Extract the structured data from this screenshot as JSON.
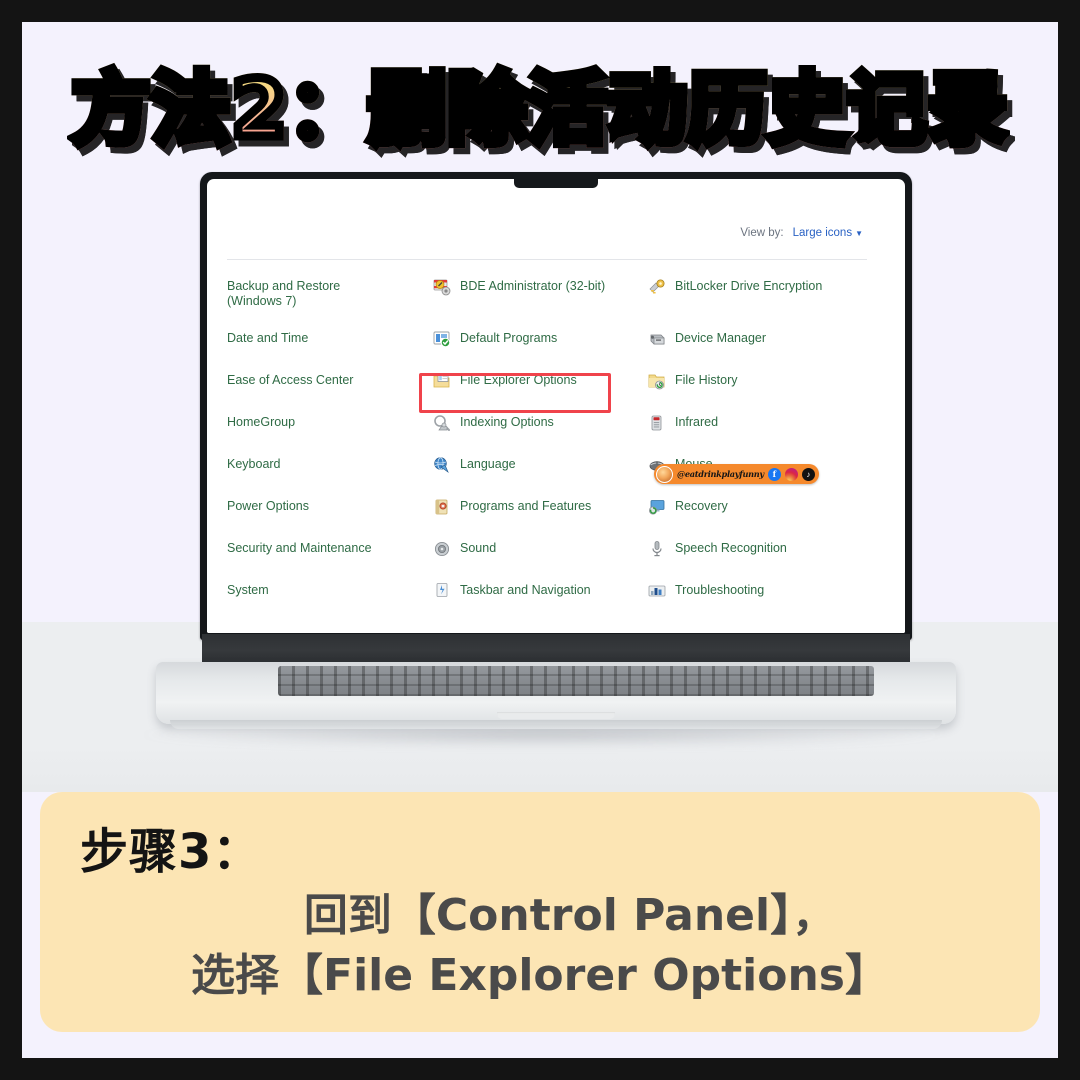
{
  "title": "方法2：删除活动历史记录",
  "control_panel": {
    "view_by": {
      "label": "View by:",
      "value": "Large icons",
      "caret": "▼"
    },
    "items": [
      [
        {
          "label": "Backup and Restore\n(Windows 7)",
          "icon": ""
        },
        {
          "label": "BDE Administrator (32-bit)",
          "icon": "bde-administrator-icon"
        },
        {
          "label": "BitLocker Drive Encryption",
          "icon": "bitlocker-icon"
        }
      ],
      [
        {
          "label": "Date and Time",
          "icon": ""
        },
        {
          "label": "Default Programs",
          "icon": "default-programs-icon"
        },
        {
          "label": "Device Manager",
          "icon": "device-manager-icon"
        }
      ],
      [
        {
          "label": "Ease of Access Center",
          "icon": ""
        },
        {
          "label": "File Explorer Options",
          "icon": "file-explorer-options-icon"
        },
        {
          "label": "File History",
          "icon": "file-history-icon"
        }
      ],
      [
        {
          "label": "HomeGroup",
          "icon": ""
        },
        {
          "label": "Indexing Options",
          "icon": "indexing-options-icon"
        },
        {
          "label": "Infrared",
          "icon": "infrared-icon"
        }
      ],
      [
        {
          "label": "Keyboard",
          "icon": ""
        },
        {
          "label": "Language",
          "icon": "language-icon"
        },
        {
          "label": "Mouse",
          "icon": "mouse-icon"
        }
      ],
      [
        {
          "label": "Power Options",
          "icon": ""
        },
        {
          "label": "Programs and Features",
          "icon": "programs-and-features-icon"
        },
        {
          "label": "Recovery",
          "icon": "recovery-icon"
        }
      ],
      [
        {
          "label": "Security and Maintenance",
          "icon": ""
        },
        {
          "label": "Sound",
          "icon": "sound-icon"
        },
        {
          "label": "Speech Recognition",
          "icon": "speech-recognition-icon"
        }
      ],
      [
        {
          "label": "System",
          "icon": ""
        },
        {
          "label": "Taskbar and Navigation",
          "icon": "taskbar-and-navigation-icon"
        },
        {
          "label": "Troubleshooting",
          "icon": "troubleshooting-icon"
        }
      ]
    ],
    "highlighted_item": "File Explorer Options"
  },
  "watermark": {
    "handle": "@eatdrinkplayfunny",
    "socials": [
      "facebook",
      "instagram",
      "tiktok"
    ],
    "facebook_glyph": "f",
    "tiktok_glyph": "♪",
    "background_color": "#f5892c"
  },
  "steps": {
    "heading": "步骤3：",
    "line1": "回到【Control Panel】，",
    "line2": "选择【File Explorer Options】"
  },
  "colors": {
    "page_background": "#f4f2fd",
    "frame": "#141414",
    "desk": "#eceef0",
    "panel": "#fce5b4",
    "link": "#2a62c4",
    "item_text": "#2f6b45",
    "highlight_border": "#f0434b",
    "title_gradient_top": "#f7e593",
    "title_gradient_bottom": "#f98c86"
  }
}
